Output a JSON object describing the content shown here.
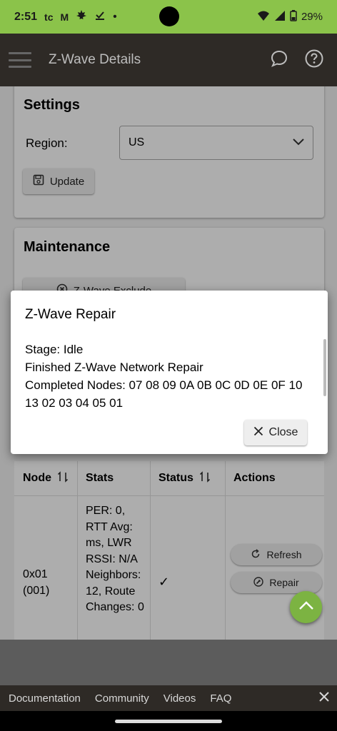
{
  "status_bar": {
    "time": "2:51",
    "app_icons": [
      "tc",
      "M"
    ],
    "dot": "•",
    "battery": "29%"
  },
  "app_bar": {
    "title": "Z-Wave Details"
  },
  "settings": {
    "title": "Settings",
    "region_label": "Region:",
    "region_value": "US",
    "update_label": "Update"
  },
  "maintenance": {
    "title": "Maintenance",
    "exclude_label": "Z-Wave Exclude"
  },
  "table": {
    "headers": {
      "node": "Node",
      "stats": "Stats",
      "status": "Status",
      "actions": "Actions"
    },
    "rows": [
      {
        "node": "0x01 (001)",
        "stats": "PER: 0, RTT Avg: ms, LWR RSSI: N/A Neighbors: 12, Route Changes: 0",
        "status": "✓",
        "refresh": "Refresh",
        "repair": "Repair"
      }
    ]
  },
  "dialog": {
    "title": "Z-Wave Repair",
    "line1": "Stage: Idle",
    "line2": "Finished Z-Wave Network Repair",
    "line3": "Completed Nodes: 07 08 09 0A 0B 0C 0D 0E 0F 10 13 02 03 04 05 01",
    "close_label": "Close"
  },
  "footer": {
    "links": [
      "Documentation",
      "Community",
      "Videos",
      "FAQ"
    ]
  },
  "colors": {
    "accent": "#8bc34a",
    "fab": "#7cb342",
    "appbar": "#2e2a26"
  }
}
